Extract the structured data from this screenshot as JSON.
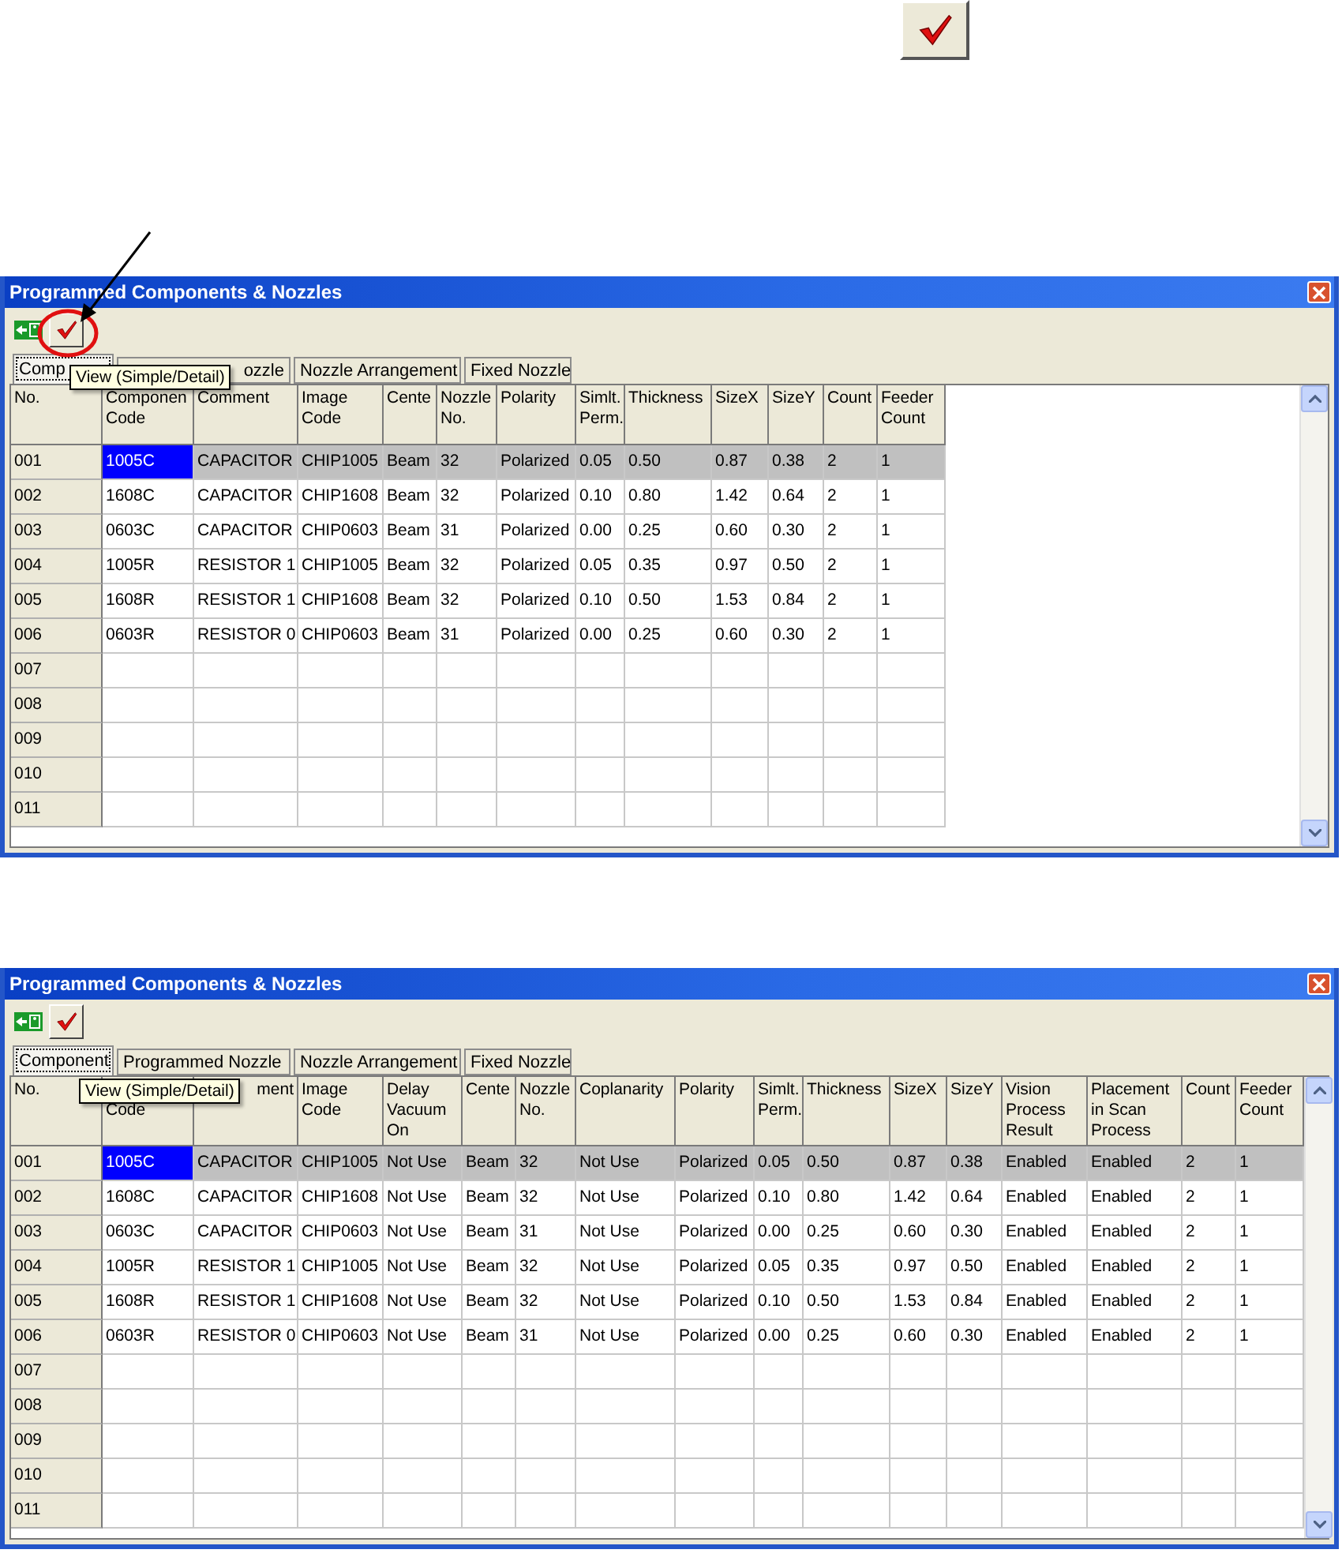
{
  "windows": [
    {
      "title": "Programmed Components & Nozzles",
      "tooltip": "View (Simple/Detail)",
      "highlighted_tool": true,
      "tabs": [
        {
          "label": "Comp",
          "selected": true
        },
        {
          "label": "ozzle",
          "selected": false,
          "right_aligned": true
        },
        {
          "label": "Nozzle Arrangement",
          "selected": false
        },
        {
          "label": "Fixed Nozzle",
          "selected": false
        }
      ],
      "columns": [
        {
          "kind": "no",
          "lines": [
            "No."
          ]
        },
        {
          "kind": "code",
          "lines": [
            "Componen",
            "Code"
          ]
        },
        {
          "kind": "comment",
          "lines": [
            "Comment"
          ]
        },
        {
          "kind": "image",
          "lines": [
            "Image",
            "Code"
          ]
        },
        {
          "kind": "center",
          "lines": [
            "Cente"
          ]
        },
        {
          "kind": "nozzle",
          "lines": [
            "Nozzle",
            "No."
          ]
        },
        {
          "kind": "polarity",
          "lines": [
            "Polarity"
          ]
        },
        {
          "kind": "simlt",
          "lines": [
            "Simlt.",
            "Perm."
          ]
        },
        {
          "kind": "thickness",
          "lines": [
            "Thickness"
          ]
        },
        {
          "kind": "sizex",
          "lines": [
            "SizeX"
          ]
        },
        {
          "kind": "sizey",
          "lines": [
            "SizeY"
          ]
        },
        {
          "kind": "count",
          "lines": [
            "Count"
          ]
        },
        {
          "kind": "feeder",
          "lines": [
            "Feeder",
            "Count"
          ]
        }
      ],
      "rows": [
        {
          "no": "001",
          "selected": true,
          "cells": [
            "1005C",
            "CAPACITOR",
            "CHIP1005",
            "Beam",
            "32",
            "Polarized",
            "0.05",
            "0.50",
            "0.87",
            "0.38",
            "2",
            "1"
          ]
        },
        {
          "no": "002",
          "selected": false,
          "cells": [
            "1608C",
            "CAPACITOR",
            "CHIP1608",
            "Beam",
            "32",
            "Polarized",
            "0.10",
            "0.80",
            "1.42",
            "0.64",
            "2",
            "1"
          ]
        },
        {
          "no": "003",
          "selected": false,
          "cells": [
            "0603C",
            "CAPACITOR",
            "CHIP0603",
            "Beam",
            "31",
            "Polarized",
            "0.00",
            "0.25",
            "0.60",
            "0.30",
            "2",
            "1"
          ]
        },
        {
          "no": "004",
          "selected": false,
          "cells": [
            "1005R",
            "RESISTOR 1",
            "CHIP1005",
            "Beam",
            "32",
            "Polarized",
            "0.05",
            "0.35",
            "0.97",
            "0.50",
            "2",
            "1"
          ]
        },
        {
          "no": "005",
          "selected": false,
          "cells": [
            "1608R",
            "RESISTOR 1",
            "CHIP1608",
            "Beam",
            "32",
            "Polarized",
            "0.10",
            "0.50",
            "1.53",
            "0.84",
            "2",
            "1"
          ]
        },
        {
          "no": "006",
          "selected": false,
          "cells": [
            "0603R",
            "RESISTOR 0",
            "CHIP0603",
            "Beam",
            "31",
            "Polarized",
            "0.00",
            "0.25",
            "0.60",
            "0.30",
            "2",
            "1"
          ]
        },
        {
          "no": "007",
          "selected": false
        },
        {
          "no": "008",
          "selected": false
        },
        {
          "no": "009",
          "selected": false
        },
        {
          "no": "010",
          "selected": false
        },
        {
          "no": "011",
          "selected": false
        }
      ]
    },
    {
      "title": "Programmed Components & Nozzles",
      "tooltip": "View (Simple/Detail)",
      "highlighted_tool": false,
      "tabs": [
        {
          "label": "Component",
          "selected": true
        },
        {
          "label": "Programmed Nozzle",
          "selected": false
        },
        {
          "label": "Nozzle Arrangement",
          "selected": false
        },
        {
          "label": "Fixed Nozzle",
          "selected": false
        }
      ],
      "columns": [
        {
          "kind": "no",
          "lines": [
            "No."
          ]
        },
        {
          "kind": "code",
          "lines": [
            "Code"
          ],
          "top_covered": true
        },
        {
          "kind": "comment",
          "lines": [
            "ment"
          ],
          "right_aligned": true
        },
        {
          "kind": "image",
          "lines": [
            "Image",
            "Code"
          ]
        },
        {
          "kind": "delay",
          "lines": [
            "Delay",
            "Vacuum",
            "On"
          ]
        },
        {
          "kind": "center",
          "lines": [
            "Cente"
          ]
        },
        {
          "kind": "nozzle",
          "lines": [
            "Nozzle",
            "No."
          ]
        },
        {
          "kind": "coplanarity",
          "lines": [
            "Coplanarity"
          ]
        },
        {
          "kind": "polarity",
          "lines": [
            "Polarity"
          ]
        },
        {
          "kind": "simlt",
          "lines": [
            "Simlt.",
            "Perm."
          ]
        },
        {
          "kind": "thickness",
          "lines": [
            "Thickness"
          ]
        },
        {
          "kind": "sizex",
          "lines": [
            "SizeX"
          ]
        },
        {
          "kind": "sizey",
          "lines": [
            "SizeY"
          ]
        },
        {
          "kind": "vision",
          "lines": [
            "Vision",
            "Process",
            "Result"
          ]
        },
        {
          "kind": "placement",
          "lines": [
            "Placement",
            "in Scan",
            "Process"
          ]
        },
        {
          "kind": "count",
          "lines": [
            "Count"
          ]
        },
        {
          "kind": "feeder",
          "lines": [
            "Feeder",
            "Count"
          ]
        }
      ],
      "rows": [
        {
          "no": "001",
          "selected": true,
          "cells": [
            "1005C",
            "CAPACITOR",
            "CHIP1005",
            "Not Use",
            "Beam",
            "32",
            "Not Use",
            "Polarized",
            "0.05",
            "0.50",
            "0.87",
            "0.38",
            "Enabled",
            "Enabled",
            "2",
            "1"
          ]
        },
        {
          "no": "002",
          "selected": false,
          "cells": [
            "1608C",
            "CAPACITOR",
            "CHIP1608",
            "Not Use",
            "Beam",
            "32",
            "Not Use",
            "Polarized",
            "0.10",
            "0.80",
            "1.42",
            "0.64",
            "Enabled",
            "Enabled",
            "2",
            "1"
          ]
        },
        {
          "no": "003",
          "selected": false,
          "cells": [
            "0603C",
            "CAPACITOR",
            "CHIP0603",
            "Not Use",
            "Beam",
            "31",
            "Not Use",
            "Polarized",
            "0.00",
            "0.25",
            "0.60",
            "0.30",
            "Enabled",
            "Enabled",
            "2",
            "1"
          ]
        },
        {
          "no": "004",
          "selected": false,
          "cells": [
            "1005R",
            "RESISTOR 1",
            "CHIP1005",
            "Not Use",
            "Beam",
            "32",
            "Not Use",
            "Polarized",
            "0.05",
            "0.35",
            "0.97",
            "0.50",
            "Enabled",
            "Enabled",
            "2",
            "1"
          ]
        },
        {
          "no": "005",
          "selected": false,
          "cells": [
            "1608R",
            "RESISTOR 1",
            "CHIP1608",
            "Not Use",
            "Beam",
            "32",
            "Not Use",
            "Polarized",
            "0.10",
            "0.50",
            "1.53",
            "0.84",
            "Enabled",
            "Enabled",
            "2",
            "1"
          ]
        },
        {
          "no": "006",
          "selected": false,
          "cells": [
            "0603R",
            "RESISTOR 0",
            "CHIP0603",
            "Not Use",
            "Beam",
            "31",
            "Not Use",
            "Polarized",
            "0.00",
            "0.25",
            "0.60",
            "0.30",
            "Enabled",
            "Enabled",
            "2",
            "1"
          ]
        },
        {
          "no": "007",
          "selected": false
        },
        {
          "no": "008",
          "selected": false
        },
        {
          "no": "009",
          "selected": false
        },
        {
          "no": "010",
          "selected": false
        },
        {
          "no": "011",
          "selected": false
        }
      ]
    }
  ]
}
